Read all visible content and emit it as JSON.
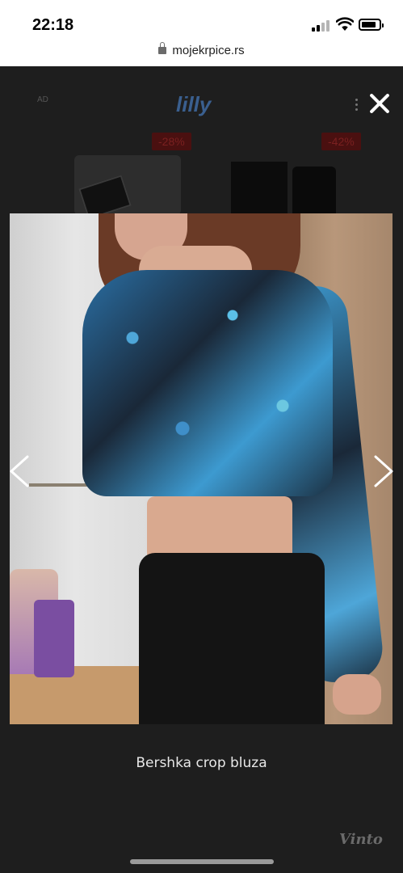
{
  "status_bar": {
    "time": "22:18",
    "url": "mojekrpice.rs"
  },
  "background_page": {
    "ad_label": "AD",
    "brand_logo": "lilly",
    "discount_badges": [
      "-28%",
      "-42%"
    ],
    "badge_color": "#e53935"
  },
  "lightbox": {
    "caption": "Bershka crop bluza",
    "watermark": "Vinto",
    "icons": {
      "close": "close-icon",
      "prev": "chevron-left-icon",
      "next": "chevron-right-icon"
    }
  }
}
